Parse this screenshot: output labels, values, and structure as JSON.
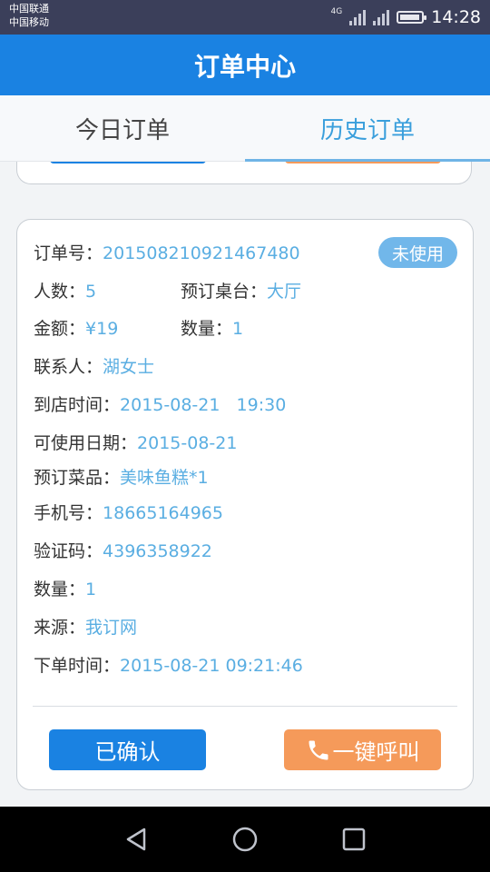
{
  "status_bar": {
    "carrier_1": "中国联通",
    "carrier_2": "中国移动",
    "network": "4G",
    "time": "14:28"
  },
  "header": {
    "title": "订单中心"
  },
  "tabs": [
    {
      "label": "今日订单",
      "active": false
    },
    {
      "label": "历史订单",
      "active": true
    }
  ],
  "order": {
    "status_badge": "未使用",
    "fields": {
      "order_no": {
        "label": "订单号：",
        "value": "201508210921467480"
      },
      "people": {
        "label": "人数：",
        "value": "5"
      },
      "table": {
        "label": "预订桌台：",
        "value": "大厅"
      },
      "amount": {
        "label": "金额：",
        "value": "¥19"
      },
      "count": {
        "label": "数量：",
        "value": "1"
      },
      "contact": {
        "label": "联系人：",
        "value": "湖女士"
      },
      "arrival_time": {
        "label": "到店时间：",
        "value": "2015-08-21   19:30"
      },
      "valid_date": {
        "label": "可使用日期：",
        "value": "2015-08-21"
      },
      "dishes": {
        "label": "预订菜品：",
        "value": "美味鱼糕*1"
      },
      "phone": {
        "label": "手机号：",
        "value": "18665164965"
      },
      "verify_code": {
        "label": "验证码：",
        "value": "4396358922"
      },
      "quantity": {
        "label": "数量：",
        "value": "1"
      },
      "source": {
        "label": "来源：",
        "value": "我订网"
      },
      "order_time": {
        "label": "下单时间：",
        "value": "2015-08-21 09:21:46"
      }
    },
    "confirm_label": "已确认",
    "call_label": "一键呼叫"
  },
  "colors": {
    "primary": "#1a82e2",
    "accent_orange": "#f59a5a",
    "value_blue": "#5aaee2",
    "badge_blue": "#71b7ea"
  },
  "icons": {
    "phone": "phone-icon",
    "nav_back": "back-triangle-icon",
    "nav_home": "home-circle-icon",
    "nav_recent": "recent-square-icon"
  }
}
